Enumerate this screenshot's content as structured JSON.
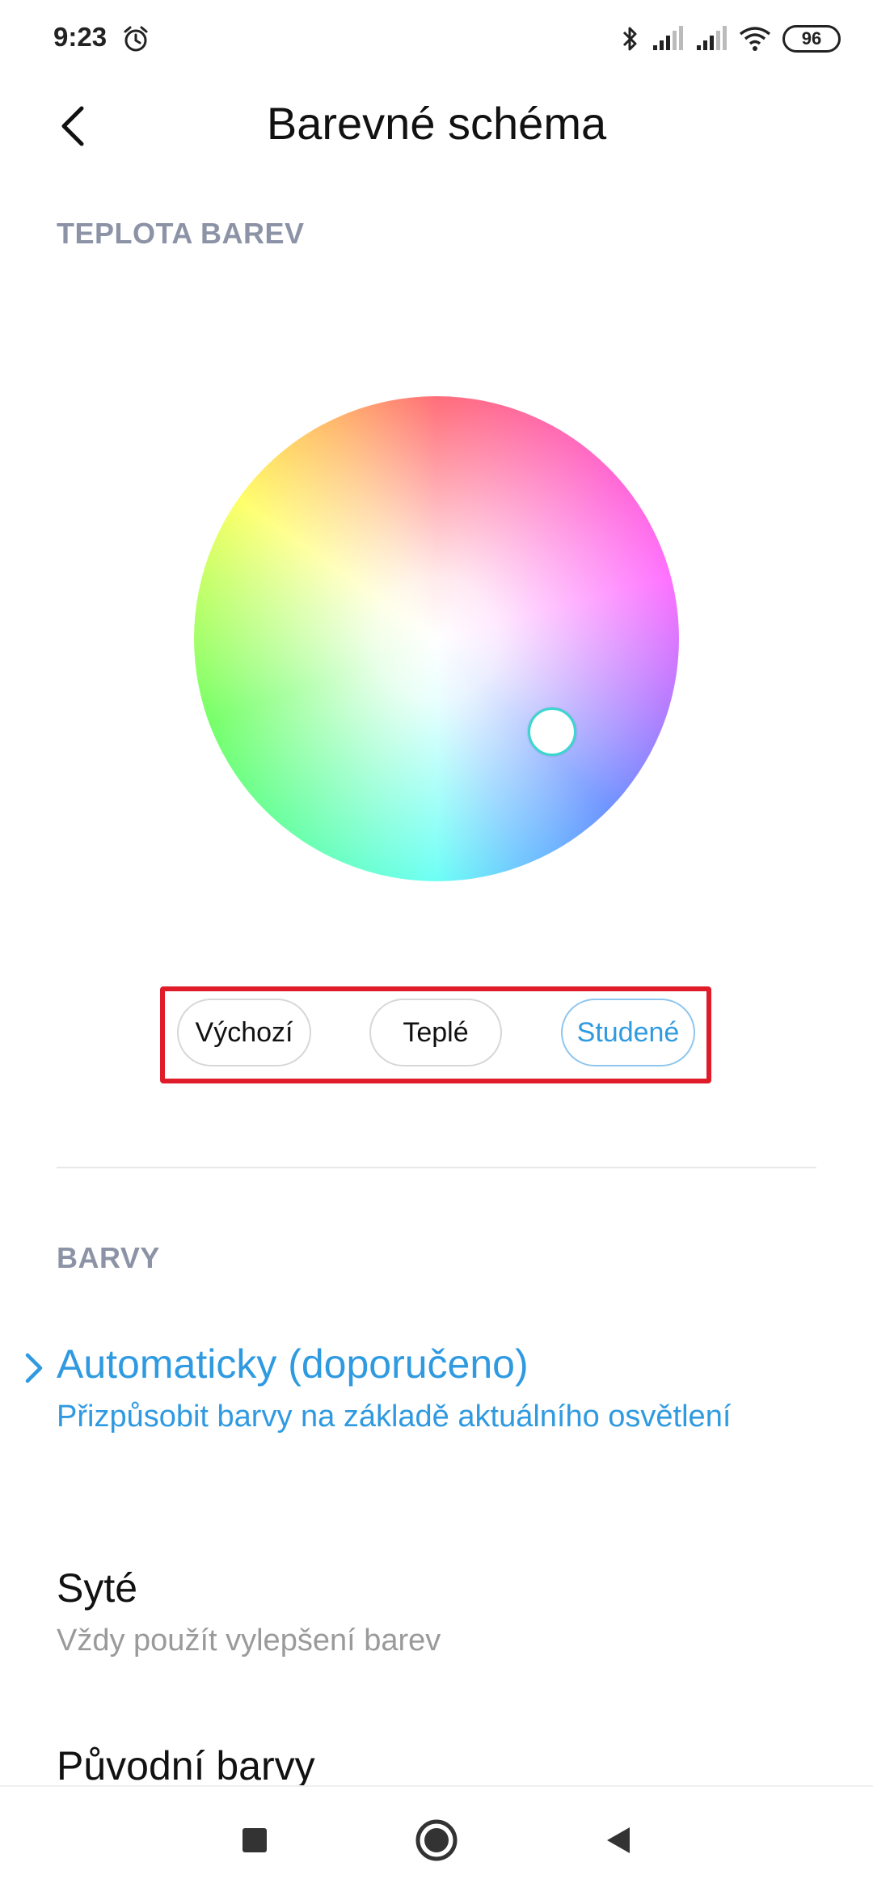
{
  "status": {
    "time": "9:23",
    "battery": "96",
    "icons": [
      "alarm-icon",
      "bluetooth-icon",
      "signal-icon",
      "signal-icon",
      "wifi-icon",
      "battery-icon"
    ]
  },
  "header": {
    "title": "Barevné schéma",
    "back_icon": "chevron-left-icon"
  },
  "temperature": {
    "section_title": "TEPLOTA BAREV",
    "presets": [
      {
        "label": "Výchozí",
        "selected": false
      },
      {
        "label": "Teplé",
        "selected": false
      },
      {
        "label": "Studené",
        "selected": true
      }
    ]
  },
  "colors": {
    "section_title": "BARVY",
    "options": [
      {
        "title": "Automaticky (doporučeno)",
        "subtitle": "Přizpůsobit barvy na základě aktuálního osvětlení",
        "selected": true
      },
      {
        "title": "Syté",
        "subtitle": "Vždy použít vylepšení barev",
        "selected": false
      },
      {
        "title": "Původní barvy",
        "subtitle": "",
        "selected": false
      }
    ]
  },
  "navbar": {
    "icons": [
      "recents-square-icon",
      "home-circle-icon",
      "back-triangle-icon"
    ]
  },
  "theme": {
    "accent": "#2f9ae0",
    "highlight_box": "#e01b2a",
    "section_color": "#8c93a6"
  }
}
